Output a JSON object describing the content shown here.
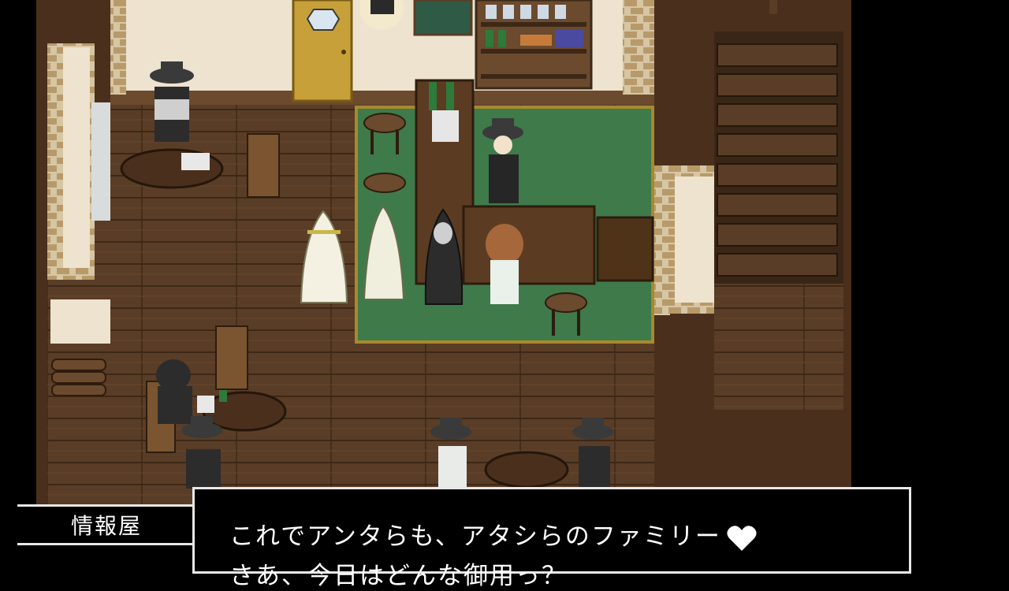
{
  "dialogue": {
    "speaker": "情報屋",
    "line1": "これでアンタらも、アタシらのファミリー",
    "line1_icon": "heart-icon",
    "line2": "さあ、今日はどんな御用っ？"
  },
  "colors": {
    "floor": "#5a3d26",
    "wall": "#ede3cf",
    "carpet": "#3f7a4a",
    "text": "#ffffff",
    "border": "#e8e8e8"
  }
}
